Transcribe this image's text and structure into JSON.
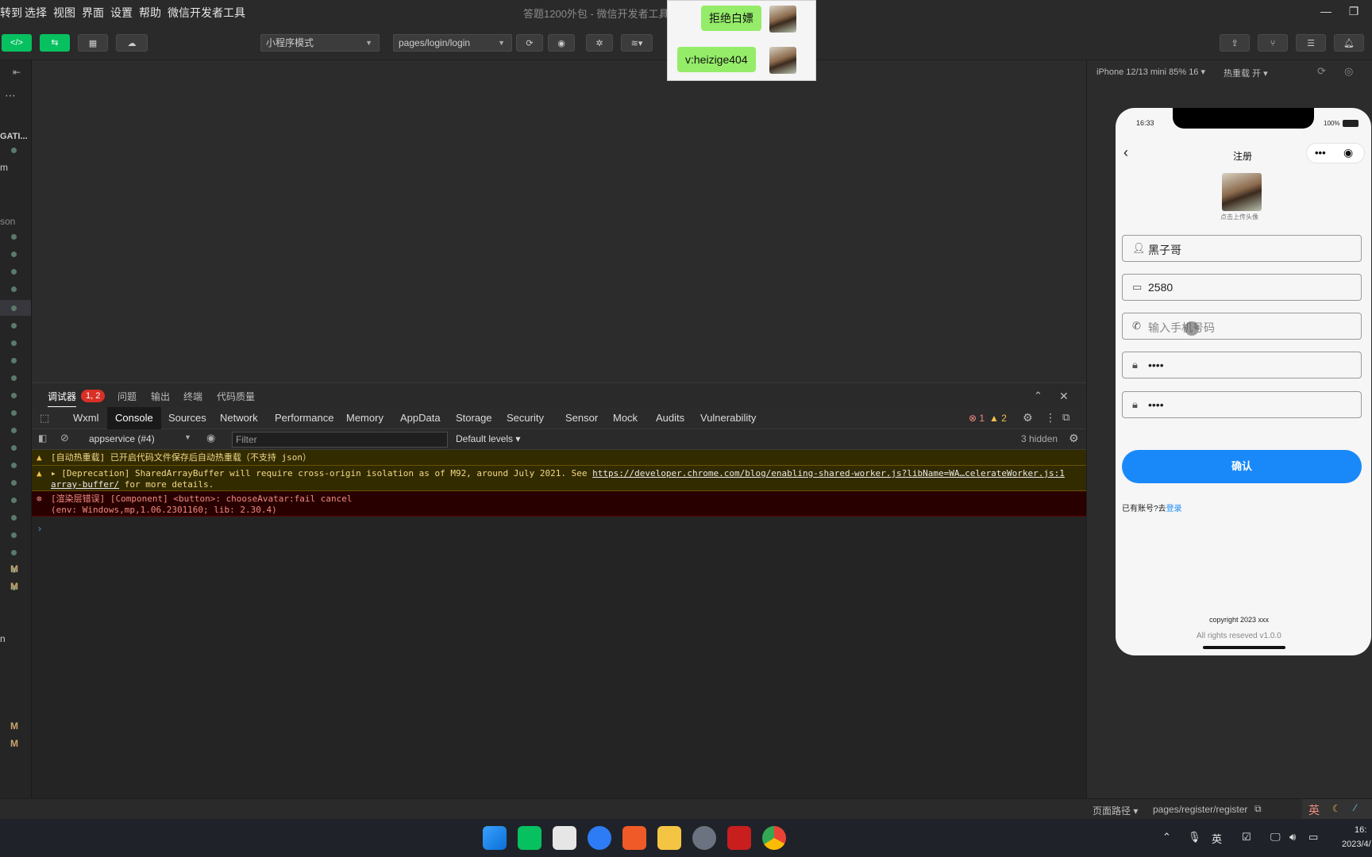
{
  "menubar": {
    "items": [
      "转到",
      "选择",
      "视图",
      "界面",
      "设置",
      "帮助",
      "微信开发者工具"
    ],
    "title": "答题1200外包 - 微信开发者工具"
  },
  "toolbar": {
    "mode": "小程序模式",
    "page_path": "pages/login/login"
  },
  "sidebar": {
    "labels": [
      "GATI...",
      "m",
      "son",
      "n"
    ],
    "badges": [
      "M",
      "M",
      "M",
      "M"
    ]
  },
  "debugger": {
    "tabs": [
      "调试器",
      "问题",
      "输出",
      "终端",
      "代码质量"
    ],
    "error_pill": "1, 2",
    "devtools_tabs": [
      "Wxml",
      "Console",
      "Sources",
      "Network",
      "Performance",
      "Memory",
      "AppData",
      "Storage",
      "Security",
      "Sensor",
      "Mock",
      "Audits",
      "Vulnerability"
    ],
    "err_count": "1",
    "warn_count": "2",
    "context": "appservice (#4)",
    "filter_placeholder": "Filter",
    "levels": "Default levels",
    "hidden": "3 hidden",
    "logs": {
      "warn1": "[自动热重载] 已开启代码文件保存后自动热重载（不支持 json）",
      "warn2_text": "[Deprecation] SharedArrayBuffer will require cross-origin isolation as of M92, around July 2021. See",
      "warn2_link": "https://developer.chrome.com/blog/enabling-shared-",
      "warn2_src": "worker.js?libName=WA…celerateWorker.js:1",
      "warn2_link2": "array-buffer/",
      "warn2_tail": "for more details.",
      "err1": "[渲染层错误] [Component] <button>: chooseAvatar:fail cancel",
      "err1_env": "(env: Windows,mp,1.06.2301160; lib: 2.30.4)"
    }
  },
  "simulator": {
    "device": "iPhone 12/13 mini 85% 16",
    "hot_reload": "热重载 开",
    "time": "16:33",
    "battery": "100%",
    "nav_title": "注册",
    "avatar_hint": "点击上传头像",
    "fields": [
      {
        "icon": "user-icon",
        "value": "黑子哥",
        "placeholder": false
      },
      {
        "icon": "id-card-icon",
        "value": "2580",
        "placeholder": false
      },
      {
        "icon": "phone-icon",
        "value": "输入手机号码",
        "placeholder": true
      },
      {
        "icon": "lock-icon",
        "value": "••••",
        "placeholder": false
      },
      {
        "icon": "lock-icon",
        "value": "••••",
        "placeholder": false
      }
    ],
    "confirm": "确认",
    "has_account": "已有账号?去",
    "login_link": "登录",
    "copyright": "copyright 2023 xxx",
    "rights": "All rights reseved v1.0.0"
  },
  "statusbar": {
    "page_path_label": "页面路径",
    "page_path": "pages/register/register",
    "ime": "英"
  },
  "chat": {
    "msg1": "拒绝白嫖",
    "msg2": "v:heizige404"
  },
  "taskbar": {
    "ime": "英",
    "time": "16:",
    "date": "2023/4/"
  },
  "colors": {
    "accent_green": "#07c160",
    "primary_blue": "#1989fa",
    "error_red": "#d93025",
    "warn_yellow": "#f2c14e"
  }
}
